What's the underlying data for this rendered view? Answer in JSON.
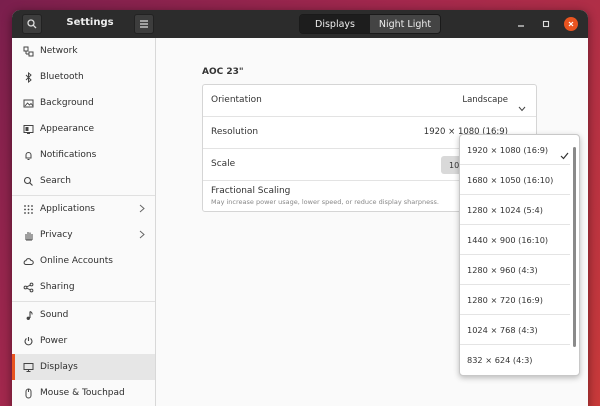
{
  "window": {
    "title": "Settings",
    "tabs": [
      {
        "label": "Displays",
        "active": true
      },
      {
        "label": "Night Light",
        "active": false
      }
    ]
  },
  "sidebar": {
    "items": [
      {
        "label": "Network",
        "icon": "network-icon"
      },
      {
        "label": "Bluetooth",
        "icon": "bluetooth-icon"
      },
      {
        "label": "Background",
        "icon": "background-icon"
      },
      {
        "label": "Appearance",
        "icon": "appearance-icon"
      },
      {
        "label": "Notifications",
        "icon": "bell-icon"
      },
      {
        "label": "Search",
        "icon": "search-icon"
      },
      {
        "label": "Applications",
        "icon": "grid-icon",
        "has_submenu": true
      },
      {
        "label": "Privacy",
        "icon": "hand-icon",
        "has_submenu": true
      },
      {
        "label": "Online Accounts",
        "icon": "cloud-icon"
      },
      {
        "label": "Sharing",
        "icon": "share-icon"
      },
      {
        "label": "Sound",
        "icon": "music-note-icon"
      },
      {
        "label": "Power",
        "icon": "power-icon"
      },
      {
        "label": "Displays",
        "icon": "monitor-icon",
        "active": true
      },
      {
        "label": "Mouse & Touchpad",
        "icon": "mouse-icon"
      }
    ]
  },
  "display": {
    "monitor_name": "AOC 23\"",
    "orientation": {
      "label": "Orientation",
      "value": "Landscape"
    },
    "resolution": {
      "label": "Resolution",
      "value": "1920 × 1080 (16:9)"
    },
    "scale": {
      "label": "Scale",
      "value": "10"
    },
    "fractional_scaling": {
      "label": "Fractional Scaling",
      "description": "May increase power usage, lower speed, or reduce display sharpness."
    }
  },
  "resolution_dropdown": {
    "options": [
      {
        "label": "1920 × 1080 (16:9)",
        "selected": true
      },
      {
        "label": "1680 × 1050 (16:10)"
      },
      {
        "label": "1280 × 1024 (5:4)"
      },
      {
        "label": "1440 × 900 (16:10)"
      },
      {
        "label": "1280 × 960 (4:3)"
      },
      {
        "label": "1280 × 720 (16:9)"
      },
      {
        "label": "1024 × 768 (4:3)"
      },
      {
        "label": "832 × 624 (4:3)"
      }
    ]
  },
  "colors": {
    "accent": "#e95420",
    "titlebar": "#2c2c2c"
  }
}
